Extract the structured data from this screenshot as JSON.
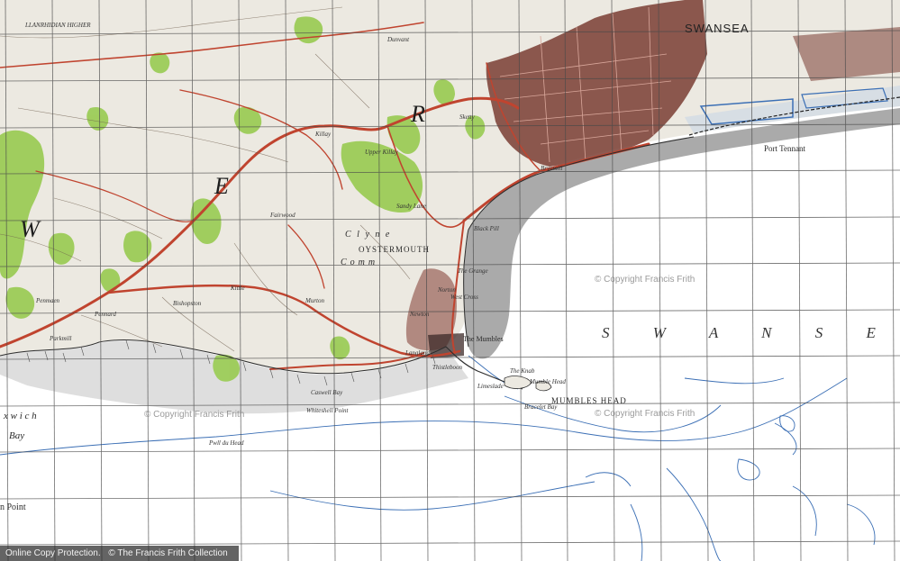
{
  "colors": {
    "land": "#ece9e1",
    "sea": "#ffffff",
    "sands": "#a8a8a8",
    "woods": "#9ccc58",
    "roads": "#c0442f",
    "urban": "#6c3a32",
    "water_lines": "#3b6fb5",
    "grid": "#4a4a4a"
  },
  "labels": {
    "swansea": "SWANSEA",
    "swansea_bay": "S W A N S E A   B",
    "mumbles_head": "MUMBLES HEAD",
    "oystermouth": "OYSTERMOUTH",
    "common": "Comm",
    "port_tennant": "Port Tennant",
    "the_mumbles": "The Mumbles",
    "the_knab": "The Knab",
    "mumble_head": "Mumble Head",
    "the_grange": "The Grange",
    "pwll_du_head": "Pwll du Head",
    "whiteshell_point": "Whiteshell Point",
    "caswell_bay": "Caswell Bay",
    "bay_left": "Bay",
    "oxwich": "x w i c h",
    "point_left": "n Point",
    "letter_e": "E",
    "letter_r": "R",
    "letter_w": "W",
    "clyne": "C l y n e",
    "llanrhidian": "LLANRHIDIAN HIGHER",
    "blackpill": "Black Pill",
    "sketty": "Sketty",
    "killay": "Killay",
    "bishopston": "Bishopston",
    "murton": "Murton",
    "newton": "Newton",
    "langland": "Langland",
    "limeslade": "Limeslade",
    "bracelet_bay": "Bracelet Bay",
    "thistleboon": "Thistleboon",
    "norton": "Norton",
    "west_cross": "West Cross",
    "pennard": "Pennard",
    "kittle": "Kittle",
    "sandy_lane": "Sandy Lane",
    "brynmill": "Brynmill",
    "dunvant": "Dunvant",
    "upper_killay": "Upper Killay",
    "fairwood": "Fairwood",
    "parkmill": "Parkmill",
    "penmaen": "Penmaen"
  },
  "watermarks": [
    "© Copyright Francis Frith",
    "© Copyright Francis Frith",
    "© Copyright Francis Frith"
  ],
  "footer": {
    "online_copy": "Online Copy Protection.",
    "copyright": "© The Francis Frith Collection"
  }
}
